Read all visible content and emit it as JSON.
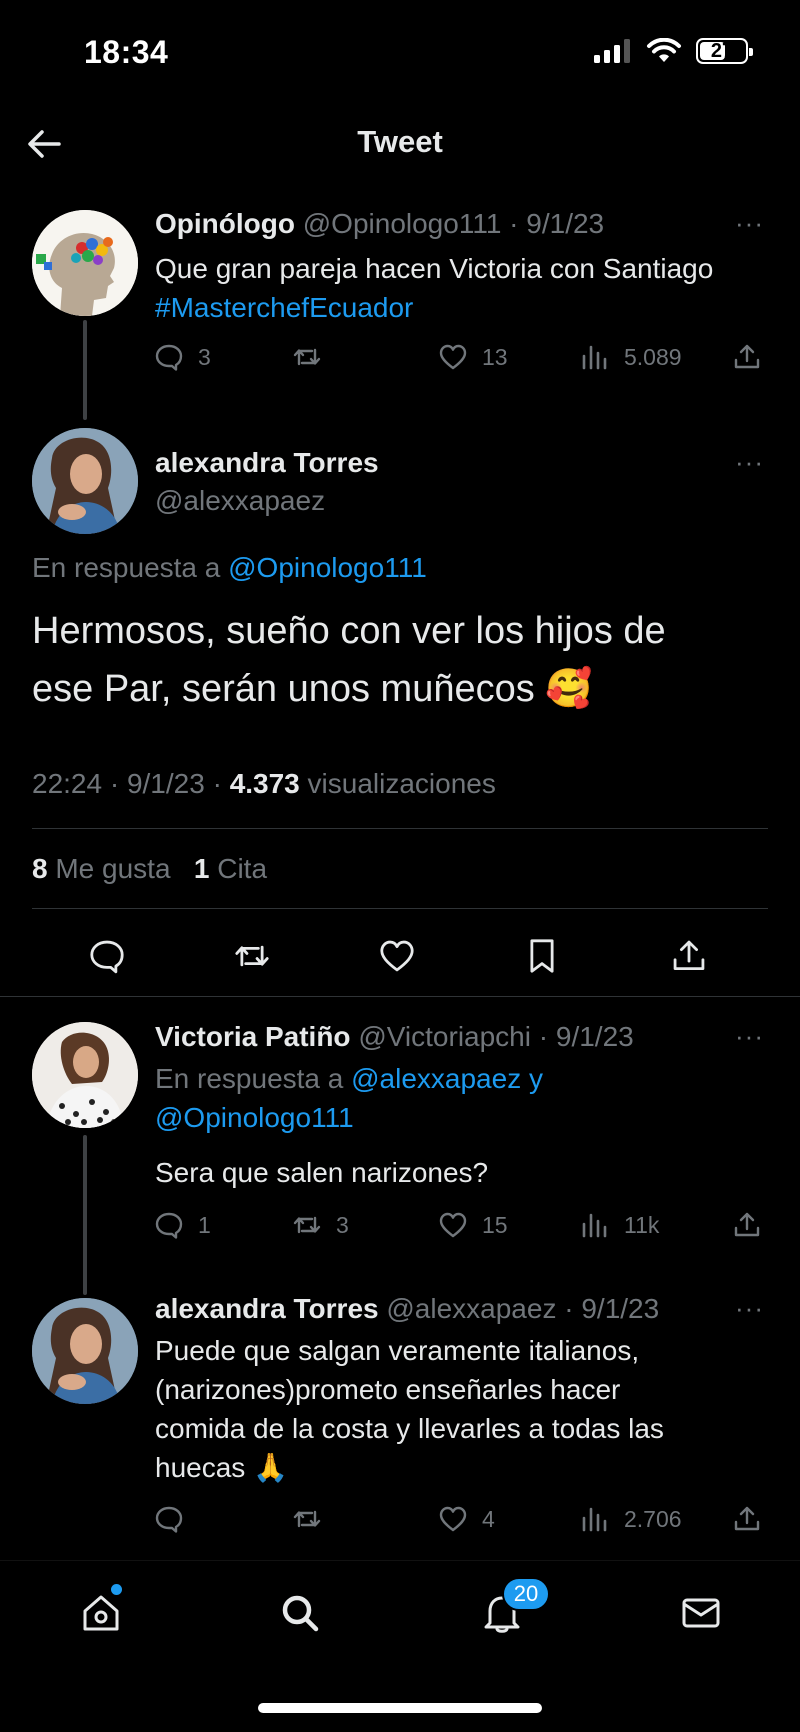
{
  "status_bar": {
    "time": "18:34",
    "battery": "27",
    "battery_level": 0.27
  },
  "nav": {
    "title": "Tweet",
    "back_icon": "arrow-left-icon"
  },
  "tweets": [
    {
      "name": "Opinólogo",
      "handle": "@Opinologo111",
      "date": "· 9/1/23",
      "more": "···",
      "text": "Que gran pareja hacen Victoria con Santiago",
      "hashtag": "#MasterchefEcuador",
      "replies": "3",
      "retweets": "",
      "likes": "13",
      "views": "5.089"
    },
    {
      "name": "Victoria Patiño",
      "handle": "@Victoriapchi",
      "date": "· 9/1/23",
      "more": "···",
      "reply_prefix": "En respuesta a",
      "reply_to_1": "@alexxapaez y",
      "reply_to_2": "@Opinologo111",
      "text": "Sera que salen narizones?",
      "replies": "1",
      "retweets": "3",
      "likes": "15",
      "views": "11k"
    },
    {
      "name": "alexandra Torres",
      "handle": "@alexxapaez",
      "date": "· 9/1/23",
      "more": "···",
      "text_lines": [
        "Puede que salgan veramente italianos,",
        "(narizones)prometo enseñarles hacer",
        "comida de la costa y llevarles a todas las",
        "huecas 🙏"
      ],
      "replies": "",
      "retweets": "",
      "likes": "4",
      "views": "2.706"
    }
  ],
  "main_tweet": {
    "name": "alexandra Torres",
    "handle": "@alexxapaez",
    "more": "···",
    "reply_prefix": "En respuesta a",
    "reply_to": "@Opinologo111",
    "text_line1": "Hermosos, sueño con ver los hijos de",
    "text_line2": "ese Par, serán unos muñecos 🥰",
    "time": "22:24 · 9/1/23 ·",
    "views_count": "4.373",
    "views_label": "visualizaciones",
    "likes_count": "8",
    "likes_label": "Me gusta",
    "quotes_count": "1",
    "quotes_label": "Cita"
  },
  "bottom_nav": {
    "items": [
      "home-icon",
      "search-icon",
      "notifications-icon",
      "messages-icon"
    ],
    "notifications_badge": "20"
  },
  "colors": {
    "accent": "#1d9bf0",
    "muted": "#71767b",
    "text": "#e7e9ea",
    "background": "#000000"
  }
}
